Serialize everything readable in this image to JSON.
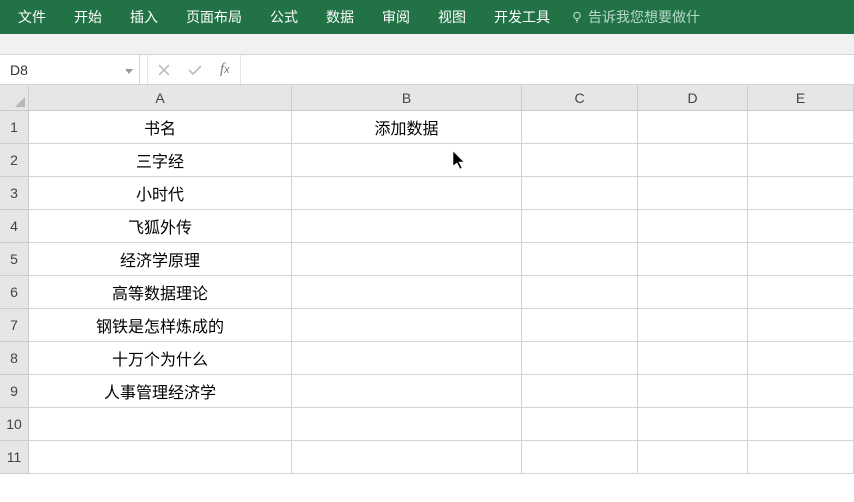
{
  "ribbon": {
    "tabs": [
      "文件",
      "开始",
      "插入",
      "页面布局",
      "公式",
      "数据",
      "审阅",
      "视图",
      "开发工具"
    ],
    "tell_me": "告诉我您想要做什"
  },
  "formula_bar": {
    "name_box": "D8",
    "formula": ""
  },
  "columns": [
    "A",
    "B",
    "C",
    "D",
    "E"
  ],
  "row_count": 11,
  "cells": {
    "A1": "书名",
    "B1": "添加数据",
    "A2": "三字经",
    "A3": "小时代",
    "A4": "飞狐外传",
    "A5": "经济学原理",
    "A6": "高等数据理论",
    "A7": "钢铁是怎样炼成的",
    "A8": "十万个为什么",
    "A9": "人事管理经济学"
  }
}
